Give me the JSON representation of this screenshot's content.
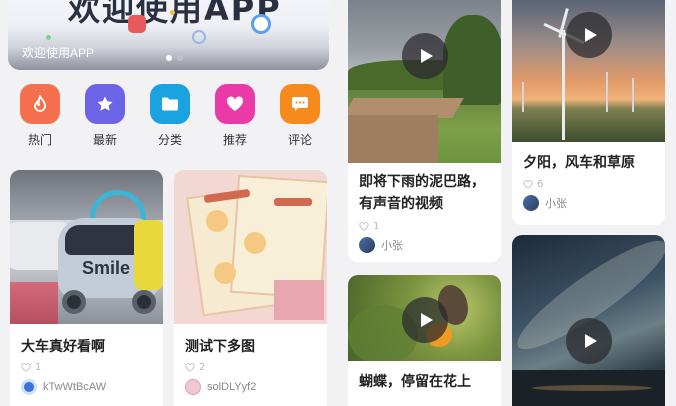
{
  "banner": {
    "headline": "欢迎使用APP",
    "caption": "欢迎使用APP",
    "dots": 2,
    "active_dot": 0
  },
  "categories": [
    {
      "label": "热门",
      "icon": "flame-icon",
      "glyph": "🔥",
      "color": "#f4704f"
    },
    {
      "label": "最新",
      "icon": "star-icon",
      "glyph": "★",
      "color": "#6c63e6"
    },
    {
      "label": "分类",
      "icon": "folder-icon",
      "glyph": "▬",
      "color": "#1aa3e0"
    },
    {
      "label": "推荐",
      "icon": "heart-icon",
      "glyph": "♥",
      "color": "#e93aa7"
    },
    {
      "label": "评论",
      "icon": "comment-icon",
      "glyph": "…",
      "color": "#f78a1d"
    }
  ],
  "feed": {
    "left_col": [
      {
        "title": "大车真好看啊",
        "likes": "1",
        "author": "kTwWtBcAW",
        "type": "image"
      },
      {
        "title": "测试下多图",
        "likes": "2",
        "author": "solDLYyf2",
        "type": "image"
      }
    ],
    "middle_col": [
      {
        "title": "即将下雨的泥巴路，有声音的视频",
        "likes": "1",
        "author": "小张",
        "type": "video"
      },
      {
        "title": "蝴蝶，停留在花上",
        "likes": "",
        "author": "",
        "type": "video"
      }
    ],
    "right_col": [
      {
        "title": "夕阳，风车和草原",
        "likes": "6",
        "author": "小张",
        "type": "video"
      },
      {
        "title": "",
        "likes": "",
        "author": "",
        "type": "video"
      }
    ]
  },
  "colors": {
    "background": "#f2f2f4",
    "card": "#ffffff",
    "title_text": "#222222",
    "meta_text": "#b7b7b7"
  }
}
